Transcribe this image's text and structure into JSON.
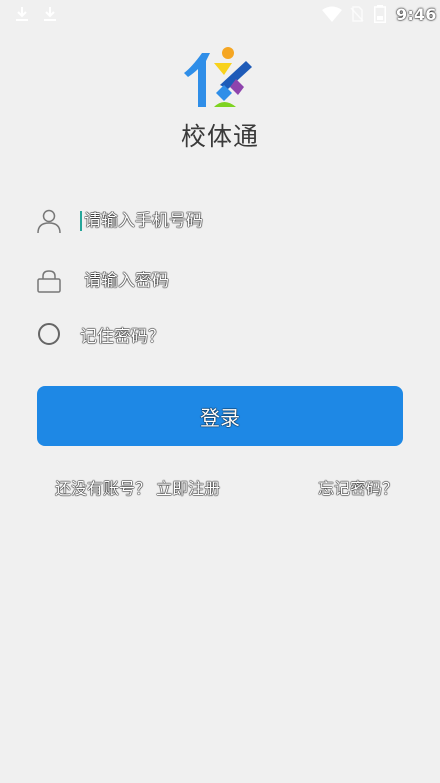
{
  "status_bar": {
    "time": "9:46",
    "icons": [
      "download-icon",
      "download-icon",
      "wifi-icon",
      "no-sim-icon",
      "battery-icon"
    ]
  },
  "logo": {
    "app_name": "校体通",
    "colors": {
      "blue": "#2f8ee8",
      "orange": "#f5a623",
      "yellow": "#f8d21c",
      "purple": "#8e44ad",
      "green": "#7ed321",
      "navy": "#1e5bb8"
    }
  },
  "form": {
    "phone_placeholder": "请输入手机号码",
    "password_placeholder": "请输入密码",
    "remember_label": "记住密码？"
  },
  "login_button_label": "登录",
  "links": {
    "register": "还没有账号？ 立即注册",
    "forgot": "忘记密码？"
  },
  "theme": {
    "primary": "#1e88e5",
    "background": "#f0f0f0"
  }
}
